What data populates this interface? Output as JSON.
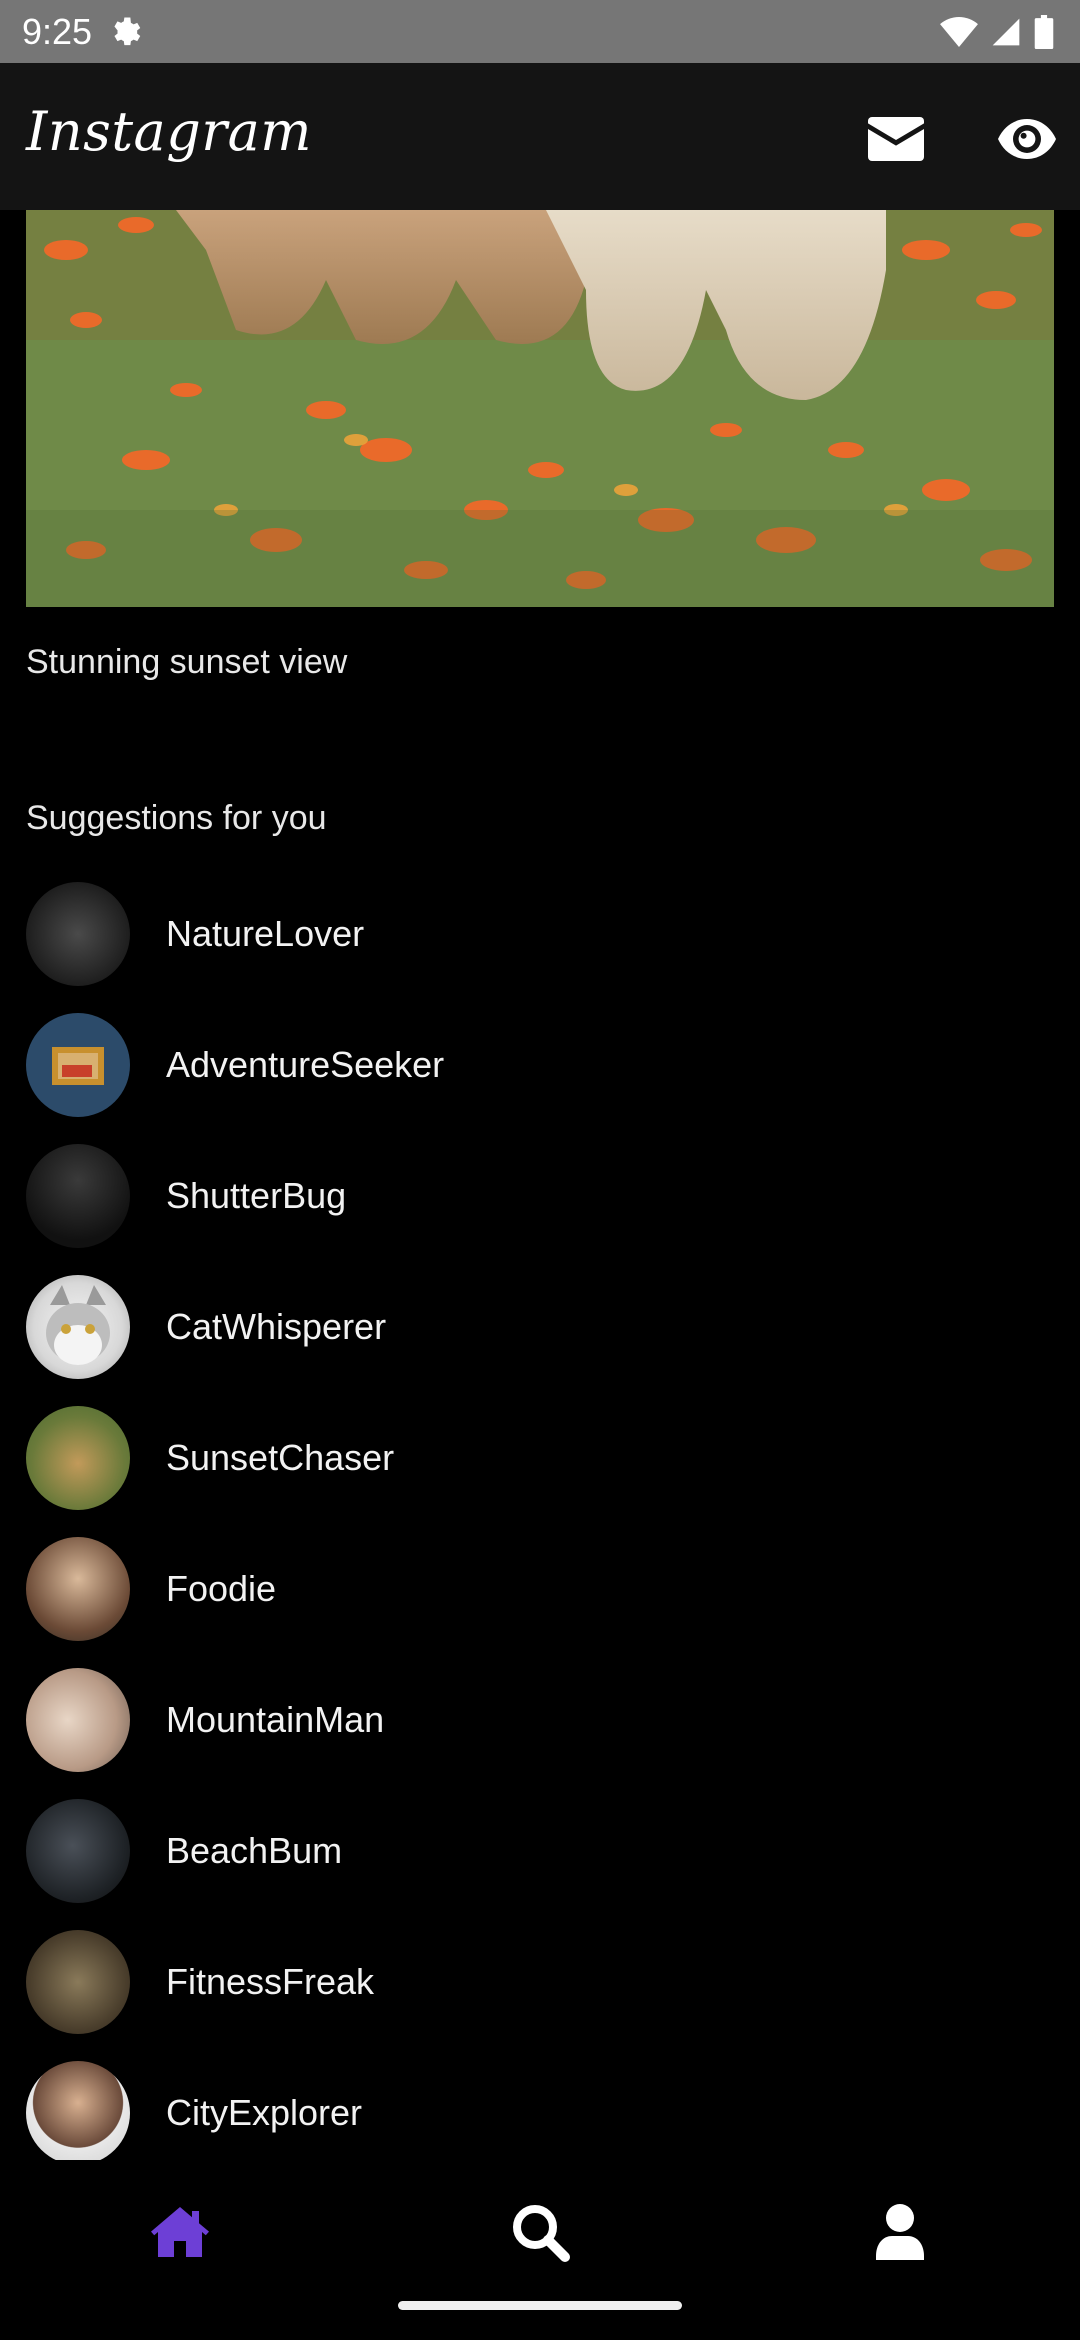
{
  "status_bar": {
    "time": "9:25"
  },
  "app_bar": {
    "title": "Instagram",
    "icons": [
      "envelope-icon",
      "eye-icon"
    ]
  },
  "post": {
    "caption": "Stunning sunset view"
  },
  "suggestions": {
    "heading": "Suggestions for you",
    "users": [
      {
        "name": "NatureLover"
      },
      {
        "name": "AdventureSeeker"
      },
      {
        "name": "ShutterBug"
      },
      {
        "name": "CatWhisperer"
      },
      {
        "name": "SunsetChaser"
      },
      {
        "name": "Foodie"
      },
      {
        "name": "MountainMan"
      },
      {
        "name": "BeachBum"
      },
      {
        "name": "FitnessFreak"
      },
      {
        "name": "CityExplorer"
      }
    ]
  },
  "bottom_nav": {
    "items": [
      "home-icon",
      "search-icon",
      "profile-icon"
    ],
    "active_item": "home-icon",
    "active_color": "#6d3fd6",
    "inactive_color": "#ffffff"
  }
}
